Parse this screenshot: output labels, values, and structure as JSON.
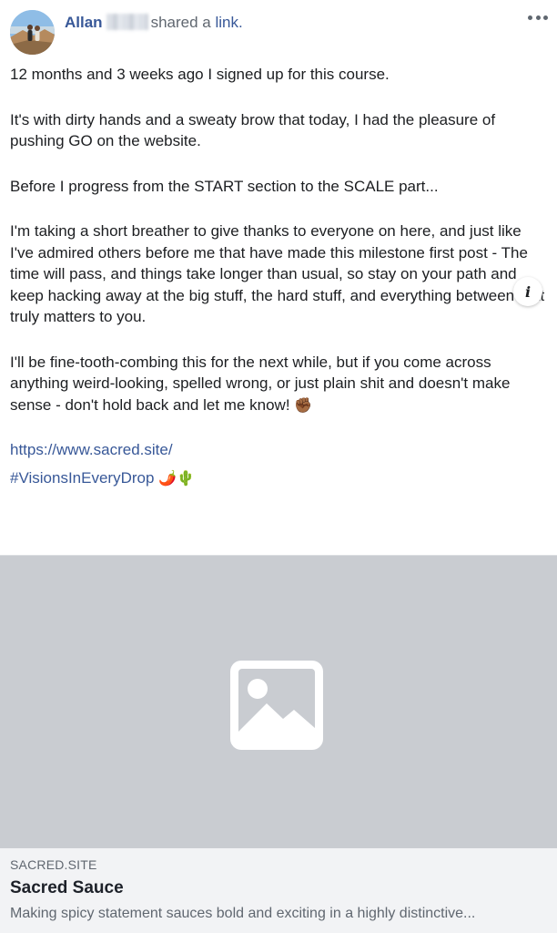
{
  "post": {
    "author_name": "Allan",
    "action_text": "shared a",
    "action_link": "link.",
    "paragraphs": [
      "12 months and 3 weeks ago I signed up for this course.",
      "It's with dirty hands and a sweaty brow that today, I had the pleasure of pushing GO on the website.",
      "Before I progress from the START section to the SCALE part...",
      "I'm taking a short breather to give thanks to everyone on here, and just like I've admired others before me that have made this milestone first post - The time will pass, and things take longer than usual, so stay on your path and keep hacking away at the big stuff, the hard stuff, and everything between that truly matters to you.",
      "I'll be fine-tooth-combing this for the next while, but if you come across anything weird-looking, spelled wrong, or just plain shit and doesn't make sense - don't hold back and let me know!"
    ],
    "fist_emoji": "✊🏾",
    "url_text": "https://www.sacred.site/",
    "hashtag": "#VisionsInEveryDrop",
    "hashtag_emoji": "🌶️🌵"
  },
  "link_preview": {
    "domain": "SACRED.SITE",
    "title": "Sacred Sauce",
    "description": "Making spicy statement sauces bold and exciting in a highly distinctive...",
    "info_label": "i"
  },
  "icons": {
    "more": "more-options-icon",
    "image_placeholder": "image-placeholder-icon",
    "info": "info-icon"
  }
}
